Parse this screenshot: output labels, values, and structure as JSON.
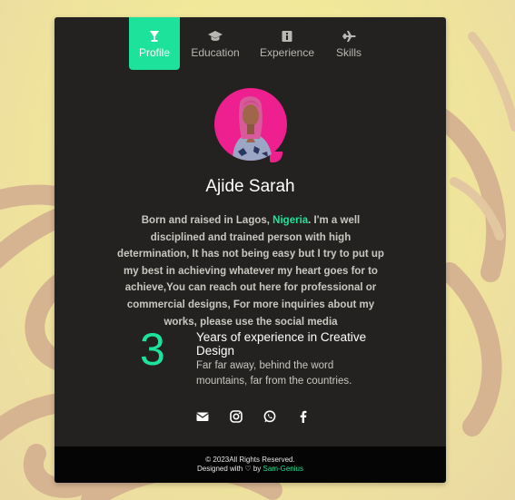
{
  "tabs": [
    {
      "label": "Profile",
      "icon": "trophy-icon",
      "active": true
    },
    {
      "label": "Education",
      "icon": "graduation-cap-icon",
      "active": false
    },
    {
      "label": "Experience",
      "icon": "briefcase-icon",
      "active": false
    },
    {
      "label": "Skills",
      "icon": "plane-icon",
      "active": false
    }
  ],
  "profile": {
    "name": "Ajide Sarah",
    "bio_before": "Born and raised in Lagos, ",
    "bio_highlight": "Nigeria",
    "bio_after": ". I'm a well disciplined and trained person with high determination, It has not being easy but I try to put up my best in achieving whatever my heart goes for to achieve,You can reach out here for professional or commercial designs, For more inquiries about my works, please use the social media"
  },
  "experience": {
    "years": "3",
    "title": "Years of experience in Creative Design",
    "description": "Far far away, behind the word mountains, far from the countries."
  },
  "social": [
    "envelope-icon",
    "instagram-icon",
    "whatsapp-icon",
    "facebook-icon"
  ],
  "footer": {
    "copyright": "© 2023All Rights Reserved.",
    "designed_prefix": "Designed with ♡ by ",
    "author": "Sam-Genius"
  },
  "colors": {
    "accent": "#1de29b",
    "card_bg": "#232220",
    "footer_bg": "#050505",
    "avatar_bg": "#ee1f8f"
  }
}
